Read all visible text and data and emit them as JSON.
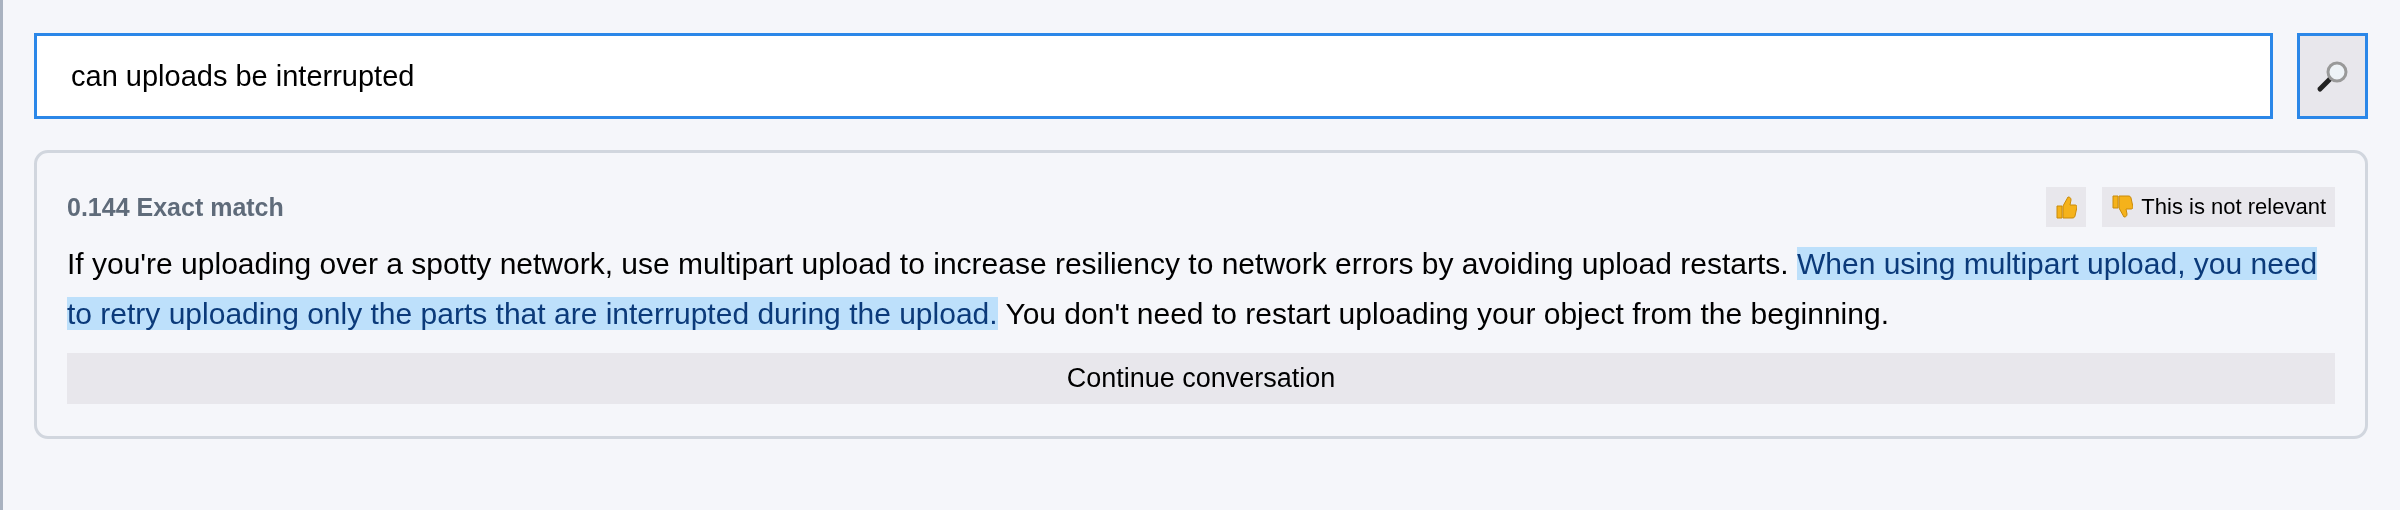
{
  "search": {
    "value": "can uploads be interrupted"
  },
  "result": {
    "score": "0.144 Exact match",
    "feedback": [
      {
        "kind": "up"
      },
      {
        "kind": "down",
        "label": "This is not relevant"
      }
    ],
    "segments": [
      {
        "text": "If you're uploading over a spotty network, use multipart upload to increase resiliency to network errors by avoiding upload restarts. ",
        "highlighted": false
      },
      {
        "text": "When using multipart upload, you need to retry uploading only the parts that are interrupted during the upload.",
        "highlighted": true
      },
      {
        "text": " You don't need to restart uploading your object from the beginning.",
        "highlighted": false
      }
    ],
    "continue_label": "Continue conversation"
  }
}
